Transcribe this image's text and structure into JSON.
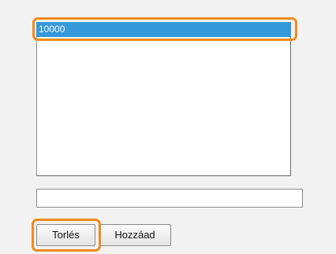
{
  "list": {
    "items": [
      "10000"
    ],
    "selected_index": 0
  },
  "input": {
    "value": ""
  },
  "buttons": {
    "delete_label": "Torlés",
    "add_label": "Hozzáad"
  },
  "colors": {
    "selection": "#3598db",
    "highlight": "#f08a1e"
  }
}
